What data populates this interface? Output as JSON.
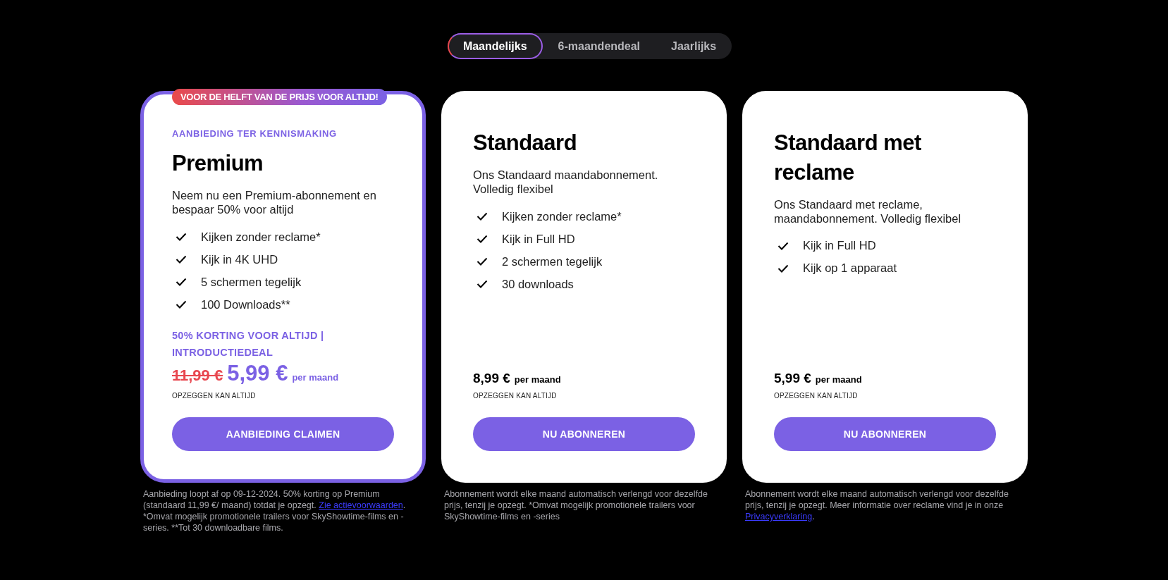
{
  "billing_tabs": [
    {
      "label": "Maandelijks",
      "selected": true
    },
    {
      "label": "6-maandendeal",
      "selected": false
    },
    {
      "label": "Jaarlijks",
      "selected": false
    }
  ],
  "plans": [
    {
      "featured": true,
      "badge": "VOOR DE HELFT VAN DE PRIJS VOOR ALTIJD!",
      "eyebrow": "AANBIEDING TER KENNISMAKING",
      "title": "Premium",
      "description": "Neem nu een Premium-abonnement en bespaar 50% voor altijd",
      "features": [
        "Kijken zonder reclame*",
        "Kijk in 4K UHD",
        "5 schermen tegelijk",
        "100 Downloads**"
      ],
      "promo": "50% KORTING VOOR ALTIJD | INTRODUCTIEDEAL",
      "old_price": "11,99 €",
      "price": "5,99 €",
      "per": "per maand",
      "cancel": "OPZEGGEN KAN ALTIJD",
      "button": "AANBIEDING CLAIMEN",
      "footnote": {
        "before": "Aanbieding loopt af op 09-12-2024. 50% korting op Premium (standaard 11,99 €/ maand) totdat je opzegt. ",
        "link": "Zie actievoorwaarden",
        "after": ". *Omvat mogelijk promotionele trailers voor SkyShowtime-films en -series. **Tot 30 downloadbare films."
      }
    },
    {
      "featured": false,
      "title": "Standaard",
      "description": "Ons Standaard maandabonnement. Volledig flexibel",
      "features": [
        "Kijken zonder reclame*",
        "Kijk in Full HD",
        "2 schermen tegelijk",
        "30 downloads"
      ],
      "price": "8,99 €",
      "per": "per maand",
      "cancel": "OPZEGGEN KAN ALTIJD",
      "button": "NU ABONNEREN",
      "footnote": {
        "before": "Abonnement wordt elke maand automatisch verlengd voor dezelfde prijs, tenzij je opzegt. *Omvat mogelijk promotionele trailers voor SkyShowtime-films en -series"
      }
    },
    {
      "featured": false,
      "title": "Standaard met reclame",
      "description": "Ons Standaard met reclame, maandabonnement. Volledig flexibel",
      "features": [
        "Kijk in Full HD",
        "Kijk op 1 apparaat"
      ],
      "price": "5,99 €",
      "per": "per maand",
      "cancel": "OPZEGGEN KAN ALTIJD",
      "button": "NU ABONNEREN",
      "footnote": {
        "before": "Abonnement wordt elke maand automatisch verlengd voor dezelfde prijs, tenzij je opzegt. Meer informatie over reclame vind je in onze ",
        "link": "Privacyverklaring",
        "after": "."
      }
    }
  ]
}
